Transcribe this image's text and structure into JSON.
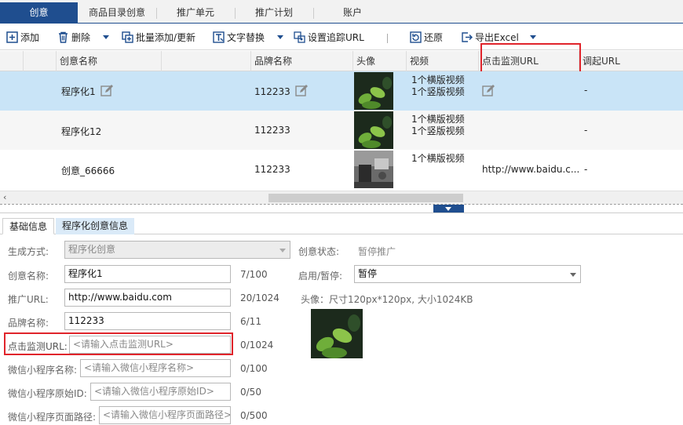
{
  "tabs": [
    "创意",
    "商品目录创意",
    "推广单元",
    "推广计划",
    "账户"
  ],
  "toolbar": {
    "add": "添加",
    "delete": "删除",
    "batch": "批量添加/更新",
    "replace": "文字替换",
    "tracking": "设置追踪URL",
    "restore": "还原",
    "export": "导出Excel"
  },
  "grid": {
    "headers": [
      "创意名称",
      "品牌名称",
      "头像",
      "视频",
      "点击监测URL",
      "调起URL"
    ],
    "rows": [
      {
        "name": "程序化1",
        "brand": "112233",
        "video1": "1个横版视频",
        "video2": "1个竖版视频",
        "click_url": "",
        "invoke_url": "-"
      },
      {
        "name": "程序化12",
        "brand": "112233",
        "video1": "1个横版视频",
        "video2": "1个竖版视频",
        "click_url": "",
        "invoke_url": "-"
      },
      {
        "name": "创意_66666",
        "brand": "112233",
        "video1": "1个横版视频",
        "video2": "",
        "click_url": "http://www.baidu.c...",
        "invoke_url": "-"
      }
    ]
  },
  "detail": {
    "tabs": [
      "基础信息",
      "程序化创意信息"
    ],
    "gen_label": "生成方式:",
    "gen_value": "程序化创意",
    "status_label": "创意状态:",
    "status_value": "暂停推广",
    "name_label": "创意名称:",
    "name_value": "程序化1",
    "name_count": "7/100",
    "enable_label": "启用/暂停:",
    "enable_value": "暂停",
    "url_label": "推广URL:",
    "url_value": "http://www.baidu.com",
    "url_count": "20/1024",
    "avatar_label": "头像：尺寸120px*120px, 大小1024KB",
    "brand_label": "品牌名称:",
    "brand_value": "112233",
    "brand_count": "6/11",
    "click_label": "点击监测URL:",
    "click_placeholder": "<请输入点击监测URL>",
    "click_count": "0/1024",
    "wx_name_label": "微信小程序名称:",
    "wx_name_placeholder": "<请输入微信小程序名称>",
    "wx_name_count": "0/100",
    "wx_id_label": "微信小程序原始ID:",
    "wx_id_placeholder": "<请输入微信小程序原始ID>",
    "wx_id_count": "0/50",
    "wx_path_label": "微信小程序页面路径:",
    "wx_path_placeholder": "<请输入微信小程序页面路径>",
    "wx_path_count": "0/500"
  }
}
